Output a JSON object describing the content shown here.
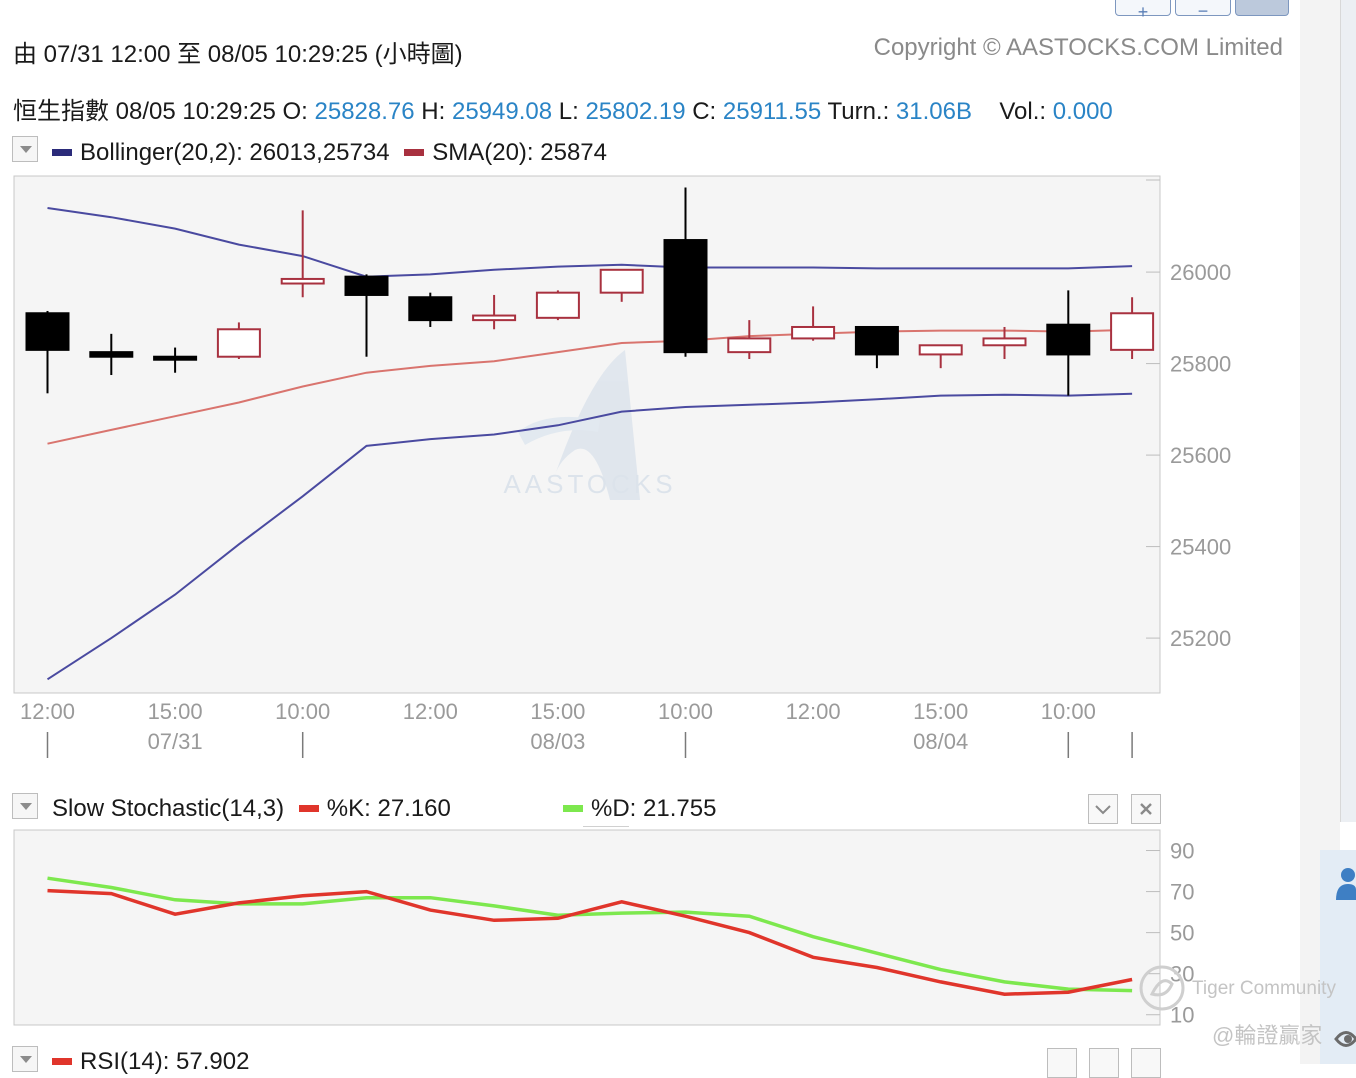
{
  "header": {
    "range_text": "由  07/31 12:00 至  08/05 10:29:25 (小時圖)",
    "copyright": "Copyright © AASTOCKS.COM Limited"
  },
  "quote": {
    "name": "恒生指數",
    "time": "08/05 10:29:25",
    "open_label": "O:",
    "open": "25828.76",
    "high_label": "H:",
    "high": "25949.08",
    "low_label": "L:",
    "low": "25802.19",
    "close_label": "C:",
    "close": "25911.55",
    "turn_label": "Turn.:",
    "turn": "31.06B",
    "vol_label": "Vol.:",
    "vol": "0.000"
  },
  "main_legend": {
    "boll": "Bollinger(20,2): 26013,25734",
    "sma": "SMA(20): 25874"
  },
  "stoch_legend": {
    "title": "Slow Stochastic(14,3)",
    "k": "%K: 27.160",
    "d": "%D: 21.755"
  },
  "rsi_legend": {
    "title": "RSI(14): 57.902"
  },
  "watermark": {
    "tiger": "Tiger Community",
    "handle": "@輪證贏家",
    "logo": "AASTOCKS"
  },
  "colors": {
    "up": "#a8313f",
    "down": "#000000",
    "boll": "#4a4aa0",
    "sma": "#d9746e",
    "k": "#e0352b",
    "d": "#7de84e",
    "value": "#2a84c6"
  },
  "chart_data": [
    {
      "type": "candlestick",
      "x_ticks": [
        {
          "i": 0,
          "time": "12:00"
        },
        {
          "i": 2,
          "time": "15:00",
          "date": "07/31"
        },
        {
          "i": 4,
          "time": "10:00"
        },
        {
          "i": 6,
          "time": "12:00"
        },
        {
          "i": 8,
          "time": "15:00",
          "date": "08/03"
        },
        {
          "i": 10,
          "time": "10:00"
        },
        {
          "i": 12,
          "time": "12:00"
        },
        {
          "i": 14,
          "time": "15:00",
          "date": "08/04"
        },
        {
          "i": 16,
          "time": "10:00"
        }
      ],
      "ylim": [
        25080,
        26210
      ],
      "y_ticks": [
        25200,
        25400,
        25600,
        25800,
        26000
      ],
      "candles": [
        {
          "o": 25910,
          "h": 25915,
          "l": 25735,
          "c": 25830
        },
        {
          "o": 25825,
          "h": 25865,
          "l": 25775,
          "c": 25815
        },
        {
          "o": 25815,
          "h": 25835,
          "l": 25780,
          "c": 25810
        },
        {
          "o": 25815,
          "h": 25890,
          "l": 25810,
          "c": 25875
        },
        {
          "o": 25975,
          "h": 26135,
          "l": 25945,
          "c": 25985
        },
        {
          "o": 25990,
          "h": 25995,
          "l": 25815,
          "c": 25950
        },
        {
          "o": 25945,
          "h": 25955,
          "l": 25880,
          "c": 25895
        },
        {
          "o": 25895,
          "h": 25950,
          "l": 25875,
          "c": 25905
        },
        {
          "o": 25900,
          "h": 25960,
          "l": 25895,
          "c": 25955
        },
        {
          "o": 25955,
          "h": 26005,
          "l": 25935,
          "c": 26005
        },
        {
          "o": 26070,
          "h": 26185,
          "l": 25815,
          "c": 25825
        },
        {
          "o": 25825,
          "h": 25895,
          "l": 25810,
          "c": 25855
        },
        {
          "o": 25855,
          "h": 25925,
          "l": 25850,
          "c": 25880
        },
        {
          "o": 25880,
          "h": 25880,
          "l": 25790,
          "c": 25820
        },
        {
          "o": 25820,
          "h": 25840,
          "l": 25790,
          "c": 25840
        },
        {
          "o": 25840,
          "h": 25880,
          "l": 25810,
          "c": 25855
        },
        {
          "o": 25885,
          "h": 25960,
          "l": 25730,
          "c": 25820
        },
        {
          "o": 25830,
          "h": 25945,
          "l": 25810,
          "c": 25910
        }
      ],
      "bollinger_upper": [
        26140,
        26120,
        26095,
        26060,
        26035,
        25990,
        25995,
        26005,
        26012,
        26016,
        26010,
        26010,
        26010,
        26008,
        26008,
        26008,
        26008,
        26013
      ],
      "bollinger_lower": [
        25110,
        25200,
        25295,
        25405,
        25510,
        25620,
        25635,
        25645,
        25665,
        25695,
        25705,
        25710,
        25715,
        25722,
        25730,
        25732,
        25730,
        25734
      ],
      "sma": [
        25625,
        25655,
        25685,
        25715,
        25750,
        25780,
        25795,
        25805,
        25825,
        25845,
        25850,
        25860,
        25865,
        25870,
        25872,
        25872,
        25870,
        25874
      ]
    },
    {
      "type": "line",
      "ylim": [
        5,
        100
      ],
      "y_ticks": [
        10,
        30,
        50,
        70,
        90
      ],
      "series": [
        {
          "name": "%K",
          "values": [
            70.5,
            69,
            59,
            64.5,
            68,
            70,
            61,
            56,
            57,
            65,
            58,
            50,
            38,
            33,
            26,
            20,
            21,
            27.16
          ]
        },
        {
          "name": "%D",
          "values": [
            76.5,
            72,
            66,
            64,
            64,
            67,
            67,
            63,
            58.5,
            59.5,
            60,
            58,
            48,
            40,
            32,
            26,
            22.5,
            21.755
          ]
        }
      ]
    }
  ]
}
